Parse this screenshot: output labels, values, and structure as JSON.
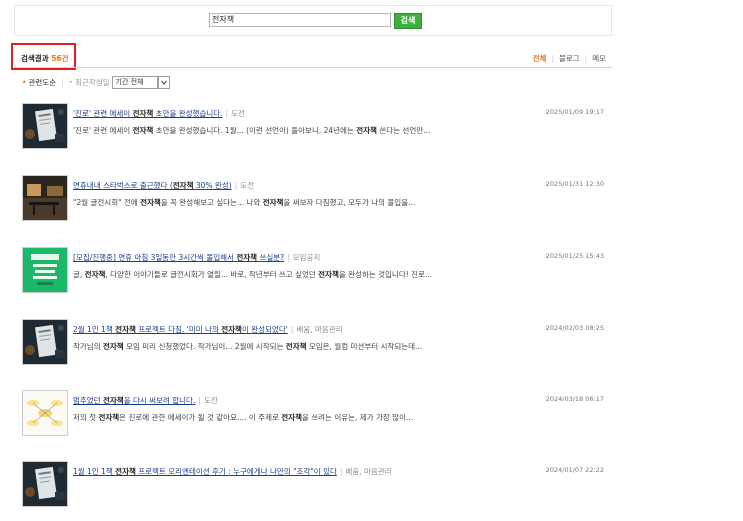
{
  "search": {
    "query": "전자책",
    "button_label": "검색"
  },
  "result_header": {
    "label": "검색결과",
    "count": "56건"
  },
  "tabs": [
    {
      "label": "전체",
      "active": true
    },
    {
      "label": "블로그",
      "active": false
    },
    {
      "label": "메모",
      "active": false
    }
  ],
  "sort": {
    "option_relevance": "관련도순",
    "option_recent": "최근작성일",
    "period_select": "기간 전체"
  },
  "colors": {
    "accent": "#e8741a",
    "search_button": "#3db13c",
    "highlight_box": "#e02020",
    "link": "#1a3d8f"
  },
  "results": [
    {
      "title_parts": [
        "'진로' 관련 에세이 ",
        "전자책",
        " 초안을 완성했습니다."
      ],
      "category": "도전",
      "date": "2025/01/09 19:17",
      "snippet_parts": [
        "'진로' 관련 에세이 ",
        "전자책",
        " 초안을 완성했습니다. 1월... (이런 선언이) 돌아보니, 24년에는 ",
        "전자책",
        " 쓴다는 선언만..."
      ],
      "thumb_icon": "book-on-table"
    },
    {
      "title_parts": [
        "연휴내내 스타벅스로 출근했다 (",
        "전자책",
        " 30% 완성)"
      ],
      "category": "도전",
      "date": "2025/01/31 12:30",
      "snippet_parts": [
        "\"2월 글전시회\" 전에 ",
        "전자책",
        "을 꼭 완성해보고 싶다는... 나와 ",
        "전자책",
        "을 써보자 다짐했고, 모두가 나의 몰입을..."
      ],
      "thumb_icon": "cafe-interior"
    },
    {
      "title_parts": [
        "[모집/진행중] 연휴 아침 3일동안 3시간씩 몰입해서 ",
        "전자책",
        " 쓰실분?"
      ],
      "category": "모임공지",
      "date": "2025/01/25 15:43",
      "snippet_parts": [
        "글, ",
        "전자책",
        ", 다양한 이야기들로 글전시회가 열릴... 바로, 작년부터 쓰고 싶었던 ",
        "전자책",
        "을 완성하는 것입니다! 진로..."
      ],
      "thumb_icon": "green-poster"
    },
    {
      "title_parts": [
        "2월 1인 1책 ",
        "전자책",
        " 프로젝트 다짐, '미미 나의 ",
        "전자책",
        "이 완성되었다'"
      ],
      "category": "배움, 마음관리",
      "date": "2024/02/03 08:25",
      "snippet_parts": [
        "작가님의 ",
        "전자책",
        " 모임 미리 신청했었다. 작가님이... 2월에 시작되는 ",
        "전자책",
        " 모임은, 월컴 미션부터 시작되는데..."
      ],
      "thumb_icon": "book-on-table"
    },
    {
      "title_parts": [
        "멈추었던 ",
        "전자책",
        "을 다시 써보려 합니다."
      ],
      "category": "도전",
      "date": "2024/03/18 06:17",
      "snippet_parts": [
        "저의 첫 ",
        "전자책",
        "은 진로에 관한 에세이가 될 것 같아요.... 이 주제로 ",
        "전자책",
        "을 쓰려는 이유는, 제가 가장 많이..."
      ],
      "thumb_icon": "mindmap-sketch"
    },
    {
      "title_parts": [
        "1월 1인 1책 ",
        "전자책",
        " 프로젝트 오리엔테이션 후기 : 누구에게나 나만의 \"조각\"이 있다"
      ],
      "category": "배움, 마음관리",
      "date": "2024/01/07 22:22",
      "snippet_parts": [],
      "thumb_icon": "book-on-table"
    }
  ]
}
